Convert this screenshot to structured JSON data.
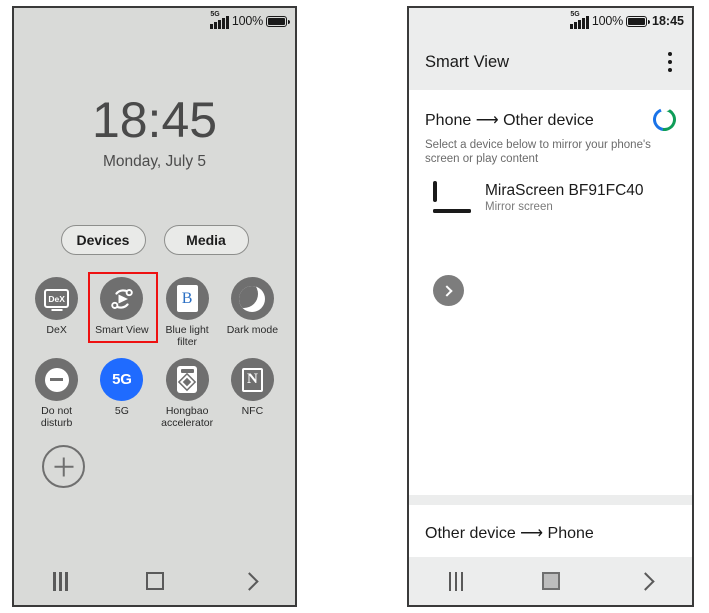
{
  "left_phone": {
    "status_bar": {
      "network": "5G",
      "battery_percent": "100%",
      "signal_icon": "signal-bars-icon",
      "battery_icon": "battery-full-icon"
    },
    "lockscreen": {
      "time": "18:45",
      "date": "Monday, July 5"
    },
    "pills": [
      {
        "label": "Devices",
        "name": "devices-tab"
      },
      {
        "label": "Media",
        "name": "media-tab"
      }
    ],
    "tiles_row1": [
      {
        "label": "DeX",
        "icon": "dex-icon",
        "active": false,
        "highlighted": false
      },
      {
        "label": "Smart View",
        "icon": "smart-view-icon",
        "active": false,
        "highlighted": true
      },
      {
        "label": "Blue light\nfilter",
        "icon": "blue-light-filter-icon",
        "active": false,
        "highlighted": false
      },
      {
        "label": "Dark mode",
        "icon": "dark-mode-icon",
        "active": false,
        "highlighted": false
      }
    ],
    "tiles_row2": [
      {
        "label": "Do not\ndisturb",
        "icon": "do-not-disturb-icon",
        "active": false,
        "highlighted": false
      },
      {
        "label": "5G",
        "icon": "five-g-icon",
        "active": true,
        "highlighted": false
      },
      {
        "label": "Hongbao\naccelerator",
        "icon": "hongbao-accelerator-icon",
        "active": false,
        "highlighted": false
      },
      {
        "label": "NFC",
        "icon": "nfc-icon",
        "active": false,
        "highlighted": false
      }
    ],
    "add_button": "add-tile-button",
    "nav_bar": {
      "recents": "recents-icon",
      "home": "home-icon",
      "back": "back-icon"
    }
  },
  "right_phone": {
    "status_bar": {
      "network": "5G",
      "battery_percent": "100%",
      "time": "18:45"
    },
    "app": {
      "title": "Smart View",
      "menu_icon": "overflow-menu-icon"
    },
    "section_phone_to_device": {
      "title": "Phone ⟶ Other device",
      "subtitle": "Select a device below to mirror your phone's screen or play content",
      "spinner": "scanning-spinner-icon",
      "devices": [
        {
          "name": "MiraScreen BF91FC40",
          "subtitle": "Mirror screen",
          "icon": "laptop-icon"
        }
      ],
      "expand_button": "expand-chevron-button"
    },
    "section_device_to_phone": {
      "title": "Other device ⟶ Phone"
    },
    "nav_bar": {
      "recents": "recents-icon",
      "home": "home-icon",
      "back": "back-icon"
    }
  },
  "colors": {
    "quick_panel_bg": "#d9dad8",
    "tile_gray": "#6f6f6f",
    "tile_active_blue": "#1f6bff",
    "highlight_red": "#ee1111",
    "spinner_blue": "#1a73e8",
    "spinner_green": "#0f9d58",
    "status_bar_gray": "#eceded"
  }
}
